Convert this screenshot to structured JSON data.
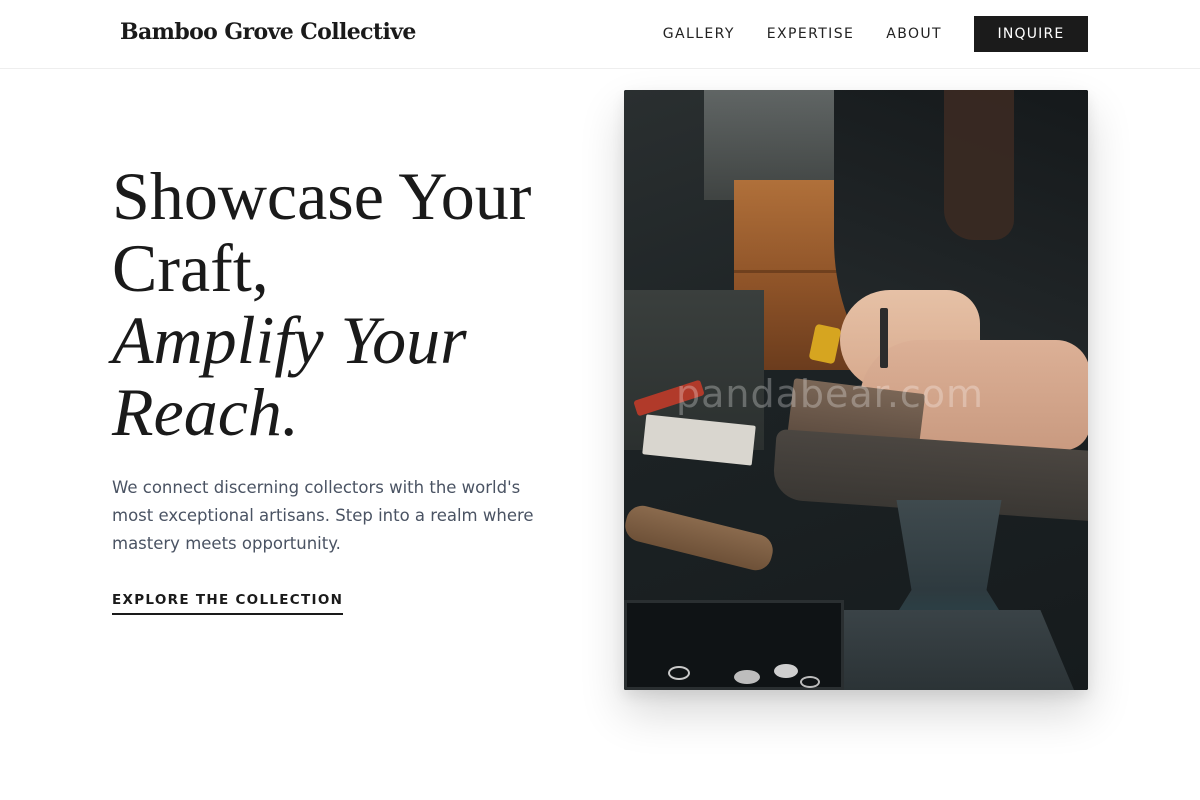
{
  "header": {
    "brand": "Bamboo Grove Collective",
    "nav": [
      {
        "label": "GALLERY"
      },
      {
        "label": "EXPERTISE"
      },
      {
        "label": "ABOUT"
      }
    ],
    "cta_label": "INQUIRE"
  },
  "hero": {
    "title_line1": "Showcase Your",
    "title_line2": "Craft,",
    "title_line3": "Amplify Your",
    "title_line4": "Reach.",
    "description": "We connect discerning collectors with the world's most exceptional artisans. Step into a realm where mastery meets opportunity.",
    "link_label": "EXPLORE THE COLLECTION",
    "image": {
      "watermark": "pandabear.com"
    }
  },
  "colors": {
    "text": "#1a1a1a",
    "muted": "#4a5363",
    "button_bg": "#1b1b1b",
    "border": "#eeeeee"
  }
}
